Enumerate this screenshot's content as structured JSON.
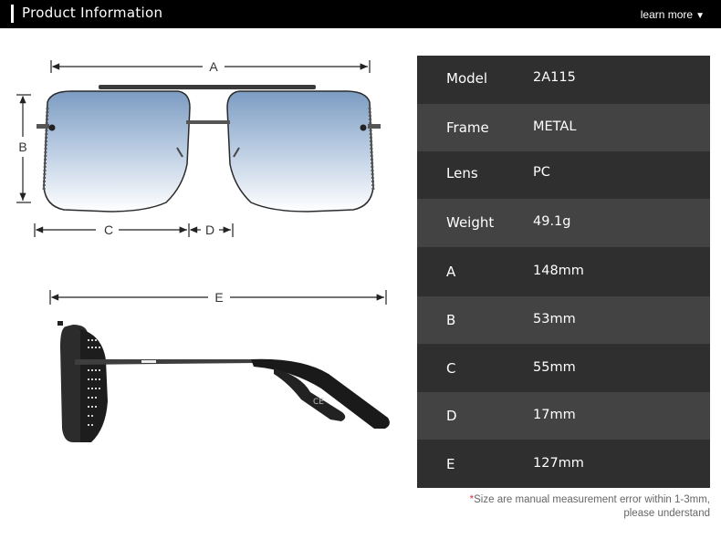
{
  "header": {
    "title": "Product Information",
    "learn_more": "learn more",
    "learn_more_icon": "triangle-down-icon"
  },
  "diagram": {
    "front_labels": {
      "a": "A",
      "b": "B",
      "c": "C",
      "d": "D"
    },
    "side_labels": {
      "e": "E"
    },
    "side_mark": "CE"
  },
  "specs": [
    {
      "key": "Model",
      "value": "2A115"
    },
    {
      "key": "Frame",
      "value": "METAL"
    },
    {
      "key": "Lens",
      "value": "PC"
    },
    {
      "key": "Weight",
      "value": "49.1g"
    },
    {
      "key": "A",
      "value": "148mm"
    },
    {
      "key": "B",
      "value": "53mm"
    },
    {
      "key": "C",
      "value": "55mm"
    },
    {
      "key": "D",
      "value": "17mm"
    },
    {
      "key": "E",
      "value": "127mm"
    }
  ],
  "note": {
    "star": "*",
    "line1": "Size are manual measurement error within 1-3mm,",
    "line2": "please understand"
  },
  "colors": {
    "row_dark": "#2f2f2f",
    "row_light": "#434343",
    "lens_top": "#7f9fc4",
    "lens_bottom": "#ffffff"
  }
}
